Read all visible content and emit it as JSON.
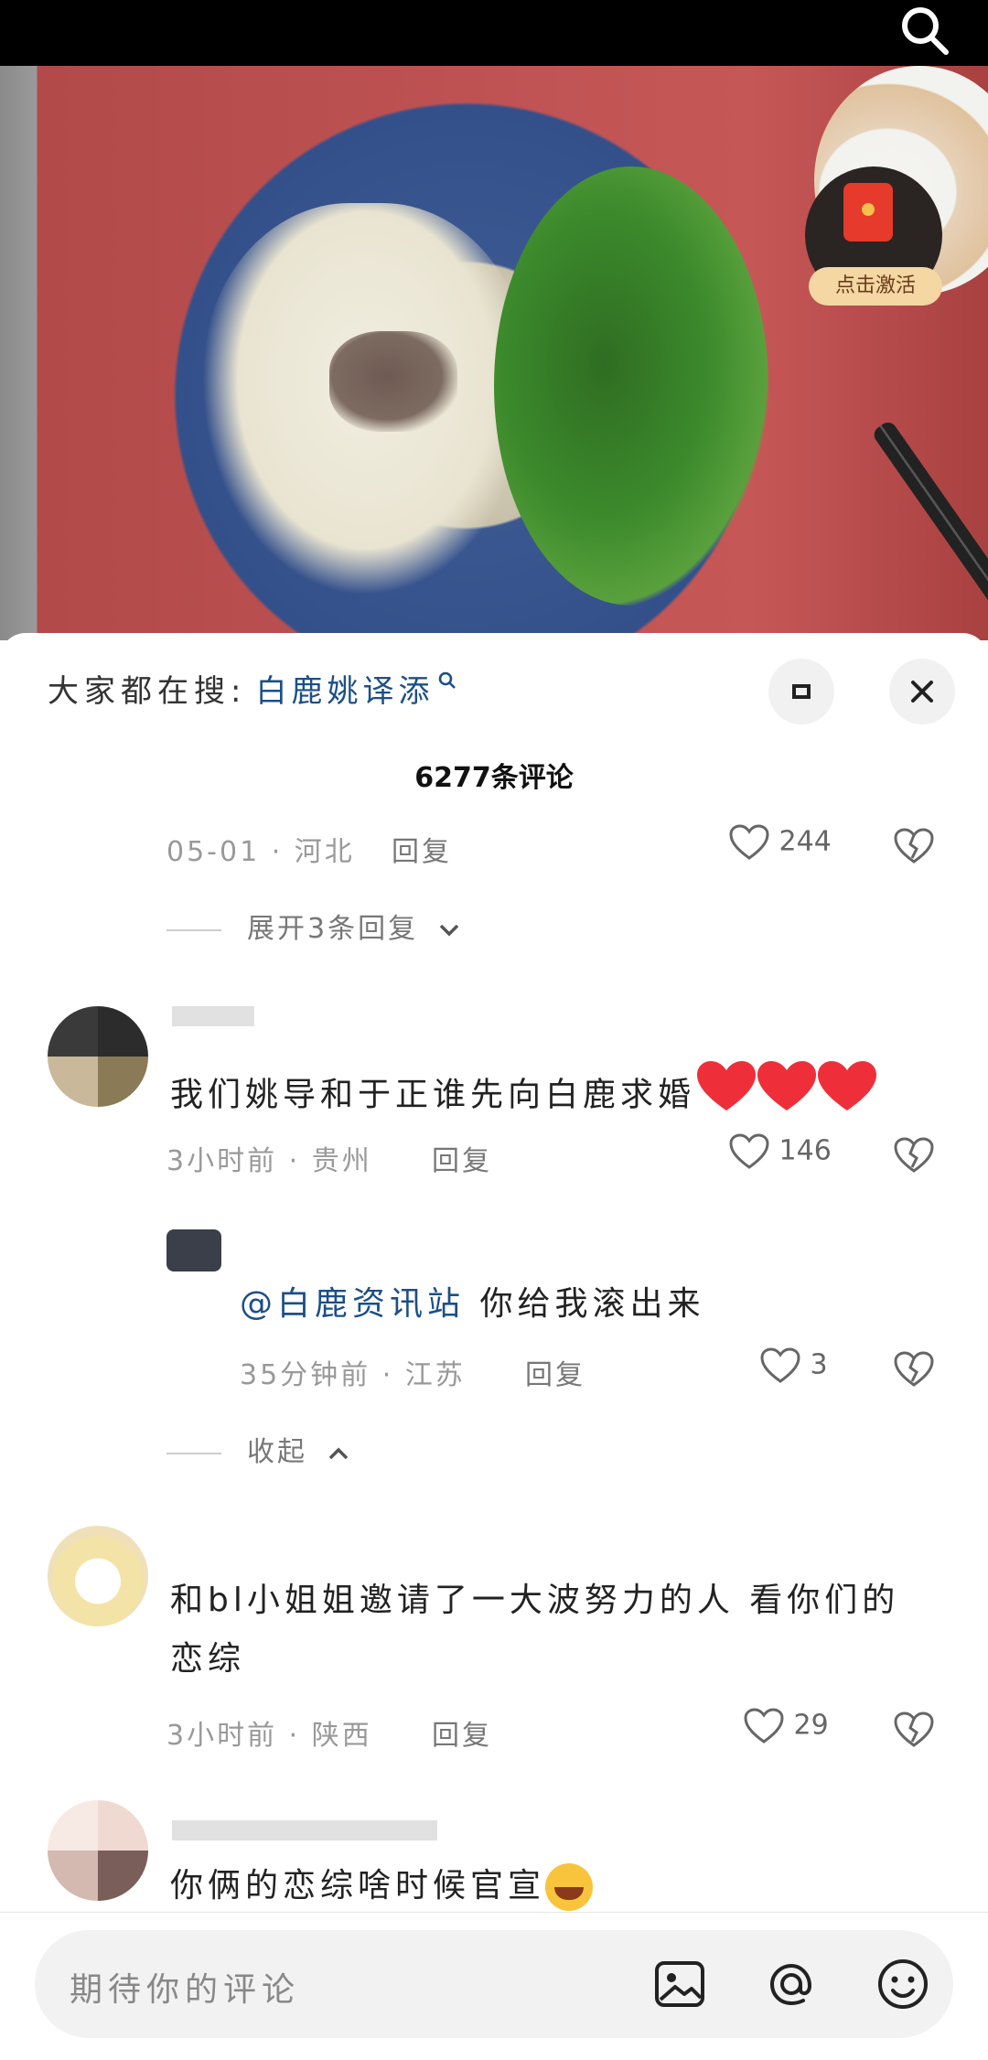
{
  "header": {
    "search_icon": "search-icon"
  },
  "media": {
    "redpacket_label": "点击激活"
  },
  "sheet": {
    "search_hint_label": "大家都在搜:",
    "search_term": "白鹿姚译添",
    "comment_count": "6277条评论"
  },
  "comments": [
    {
      "meta": "05-01 · 河北",
      "reply_label": "回复",
      "likes": "244",
      "expand_replies": "展开3条回复"
    },
    {
      "text": "我们姚导和于正谁先向白鹿求婚",
      "emoji": "❤️❤️❤️",
      "meta": "3小时前 · 贵州",
      "reply_label": "回复",
      "likes": "146",
      "sub_reply": {
        "mention": "@白鹿资讯站",
        "text": "你给我滚出来",
        "meta": "35分钟前 · 江苏",
        "reply_label": "回复",
        "likes": "3"
      },
      "collapse_label": "收起"
    },
    {
      "text_line1": "和bl小姐姐邀请了一大波努力的人 看你们的",
      "text_line2": "恋综",
      "meta": "3小时前 · 陕西",
      "reply_label": "回复",
      "likes": "29"
    },
    {
      "text": "你俩的恋综啥时候官宣",
      "emoji": "😂"
    }
  ],
  "composer": {
    "placeholder": "期待你的评论",
    "icons": [
      "image-icon",
      "at-icon",
      "emoji-icon"
    ]
  },
  "colors": {
    "link": "#1c4f86",
    "meta": "#999999",
    "bar": "#f2f2f2"
  }
}
